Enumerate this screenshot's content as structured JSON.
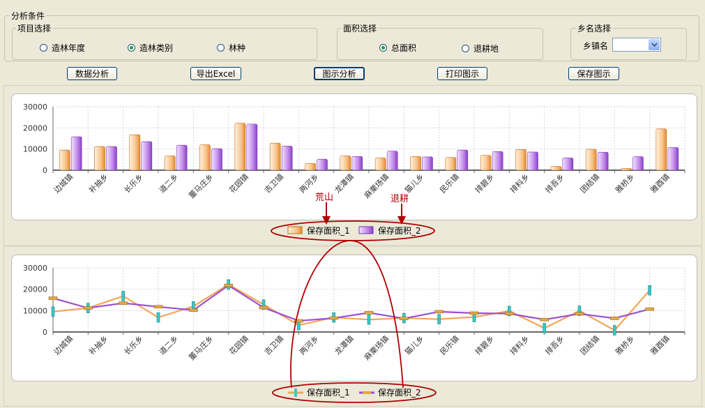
{
  "conditions": {
    "title": "分析条件",
    "project_group": {
      "title": "项目选择",
      "options": [
        {
          "label": "造林年度",
          "selected": false
        },
        {
          "label": "造林类别",
          "selected": true
        },
        {
          "label": "林种",
          "selected": false
        }
      ]
    },
    "area_group": {
      "title": "面积选择",
      "options": [
        {
          "label": "总面积",
          "selected": true
        },
        {
          "label": "退耕地",
          "selected": false
        }
      ]
    },
    "town_group": {
      "title": "乡名选择",
      "label": "乡镇名",
      "value": ""
    }
  },
  "toolbar": {
    "data_analysis": "数据分析",
    "export_excel": "导出Excel",
    "chart_analysis": "图示分析",
    "print_chart": "打印图示",
    "save_chart": "保存图示"
  },
  "annotations": {
    "barren": "荒山",
    "returned": "退耕"
  },
  "colors": {
    "series1": "#f2a65a",
    "series2": "#9b4fd1",
    "annotation": "#b00000"
  },
  "chart_data": [
    {
      "type": "bar",
      "categories": [
        "边城镇",
        "补抽乡",
        "长乐乡",
        "道二乡",
        "董马庄乡",
        "花园镇",
        "吉卫镇",
        "两河乡",
        "龙潭镇",
        "麻栗场镇",
        "猫儿乡",
        "民乐镇",
        "排碧乡",
        "排料乡",
        "排吾乡",
        "团结镇",
        "雅桥乡",
        "雅酉镇"
      ],
      "ylim": [
        0,
        30000
      ],
      "yticks": [
        "30000",
        "20000",
        "10000",
        "0"
      ],
      "series": [
        {
          "name": "保存面积_1",
          "values": [
            9500,
            11200,
            16800,
            6800,
            12000,
            22200,
            12800,
            3200,
            6800,
            5800,
            6500,
            6000,
            7000,
            9800,
            1800,
            9900,
            800,
            19500
          ]
        },
        {
          "name": "保存面积_2",
          "values": [
            15800,
            11200,
            13500,
            11800,
            10200,
            21800,
            11400,
            5200,
            6500,
            9000,
            6300,
            9500,
            8800,
            8600,
            5800,
            8500,
            6400,
            10700
          ]
        }
      ],
      "legend": "bottom"
    },
    {
      "type": "line",
      "categories": [
        "边城镇",
        "补抽乡",
        "长乐乡",
        "道二乡",
        "董马庄乡",
        "花园镇",
        "吉卫镇",
        "两河乡",
        "龙潭镇",
        "麻栗场镇",
        "猫儿乡",
        "民乐镇",
        "排碧乡",
        "排料乡",
        "排吾乡",
        "团结镇",
        "雅桥乡",
        "雅酉镇"
      ],
      "ylim": [
        0,
        30000
      ],
      "yticks": [
        "30000",
        "20000",
        "10000",
        "0"
      ],
      "series": [
        {
          "name": "保存面积_1",
          "values": [
            9500,
            11200,
            16800,
            6800,
            12000,
            22200,
            12800,
            3200,
            6800,
            5800,
            6500,
            6000,
            7000,
            9800,
            1800,
            9900,
            800,
            19500
          ]
        },
        {
          "name": "保存面积_2",
          "values": [
            15800,
            11200,
            13500,
            11800,
            10200,
            21800,
            11400,
            5200,
            6500,
            9000,
            6300,
            9500,
            8800,
            8600,
            5800,
            8500,
            6400,
            10700
          ]
        }
      ],
      "legend": "bottom"
    }
  ]
}
